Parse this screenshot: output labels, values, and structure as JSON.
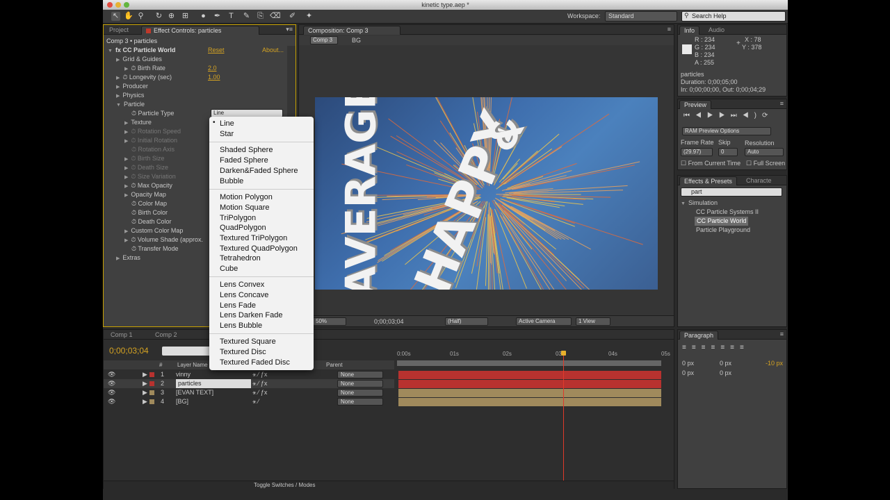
{
  "window": {
    "title": "kinetic type.aep *"
  },
  "workspace": {
    "label": "Workspace:",
    "value": "Standard"
  },
  "search": {
    "placeholder": "Search Help"
  },
  "left_panel": {
    "tabs": [
      "Project",
      "Effect Controls: particles"
    ],
    "breadcrumb": "Comp 3 • particles",
    "effect_name": "CC Particle World",
    "reset": "Reset",
    "about": "About...",
    "rows": [
      {
        "label": "Grid & Guides",
        "value": ""
      },
      {
        "label": "Birth Rate",
        "value": "2.0"
      },
      {
        "label": "Longevity (sec)",
        "value": "1.00"
      },
      {
        "label": "Producer",
        "value": ""
      },
      {
        "label": "Physics",
        "value": ""
      },
      {
        "label": "Particle",
        "value": ""
      },
      {
        "label": "Particle Type",
        "value": "Line"
      },
      {
        "label": "Texture",
        "value": ""
      },
      {
        "label": "Rotation Speed",
        "value": ""
      },
      {
        "label": "Initial Rotation",
        "value": ""
      },
      {
        "label": "Rotation Axis",
        "value": ""
      },
      {
        "label": "Birth Size",
        "value": ""
      },
      {
        "label": "Death Size",
        "value": ""
      },
      {
        "label": "Size Variation",
        "value": ""
      },
      {
        "label": "Max Opacity",
        "value": ""
      },
      {
        "label": "Opacity Map",
        "value": ""
      },
      {
        "label": "Color Map",
        "value": ""
      },
      {
        "label": "Birth Color",
        "value": ""
      },
      {
        "label": "Death Color",
        "value": ""
      },
      {
        "label": "Custom Color Map",
        "value": ""
      },
      {
        "label": "Volume Shade (approx.",
        "value": ""
      },
      {
        "label": "Transfer Mode",
        "value": ""
      },
      {
        "label": "Extras",
        "value": ""
      }
    ]
  },
  "dropdown": {
    "groups": [
      [
        "Line",
        "Star"
      ],
      [
        "Shaded Sphere",
        "Faded Sphere",
        "Darken&Faded Sphere",
        "Bubble"
      ],
      [
        "Motion Polygon",
        "Motion Square",
        "TriPolygon",
        "QuadPolygon",
        "Textured TriPolygon",
        "Textured QuadPolygon",
        "Tetrahedron",
        "Cube"
      ],
      [
        "Lens Convex",
        "Lens Concave",
        "Lens Fade",
        "Lens Darken Fade",
        "Lens Bubble"
      ],
      [
        "Textured Square",
        "Textured Disc",
        "Textured Faded Disc"
      ]
    ]
  },
  "composition": {
    "tab": "Composition: Comp 3",
    "breadcrumbs": [
      "Comp 3",
      "BG"
    ],
    "canvas_text": [
      "AVERAGE",
      "HAPPY",
      "&"
    ],
    "footer": {
      "zoom": "50%",
      "timecode": "0;00;03;04",
      "quality": "(Half)",
      "camera": "Active Camera",
      "views": "1 View"
    }
  },
  "info": {
    "tabs": [
      "Info",
      "Audio"
    ],
    "r": "R : 234",
    "g": "G : 234",
    "b": "B : 234",
    "a": "A : 255",
    "x": "X : 78",
    "y": "Y : 378",
    "layer": "particles",
    "duration": "Duration: 0;00;05;00",
    "inout": "In: 0;00;00;00, Out: 0;00;04;29"
  },
  "preview": {
    "tab": "Preview",
    "ram": "RAM Preview Options",
    "frame_rate_label": "Frame Rate",
    "skip_label": "Skip",
    "resolution_label": "Resolution",
    "frame_rate": "(29.97)",
    "skip": "0",
    "resolution": "Auto",
    "from_current": "From Current Time",
    "full_screen": "Full Screen"
  },
  "effects": {
    "tabs": [
      "Effects & Presets",
      "Characte"
    ],
    "query": "part",
    "category": "Simulation",
    "items": [
      "CC Particle Systems II",
      "CC Particle World",
      "Particle Playground"
    ]
  },
  "timeline": {
    "tabs": [
      "Comp 1",
      "Comp 2"
    ],
    "timecode": "0;00;03;04",
    "col_layer": "Layer Name",
    "col_parent": "Parent",
    "col_num": "#",
    "ruler": [
      "0:00s",
      "01s",
      "02s",
      "03s",
      "04s",
      "05s"
    ],
    "layers": [
      {
        "num": "1",
        "name": "vinny",
        "parent": "None",
        "color": "#b8322f"
      },
      {
        "num": "2",
        "name": "particles",
        "parent": "None",
        "color": "#b8322f"
      },
      {
        "num": "3",
        "name": "[EVAN TEXT]",
        "parent": "None",
        "color": "#a08a5c"
      },
      {
        "num": "4",
        "name": "[BG]",
        "parent": "None",
        "color": "#a08a5c"
      }
    ],
    "toggle": "Toggle Switches / Modes"
  },
  "paragraph": {
    "tab": "Paragraph",
    "v1": "0 px",
    "v2": "0 px",
    "v3": "-10 px",
    "v4": "0 px",
    "v5": "0 px"
  }
}
